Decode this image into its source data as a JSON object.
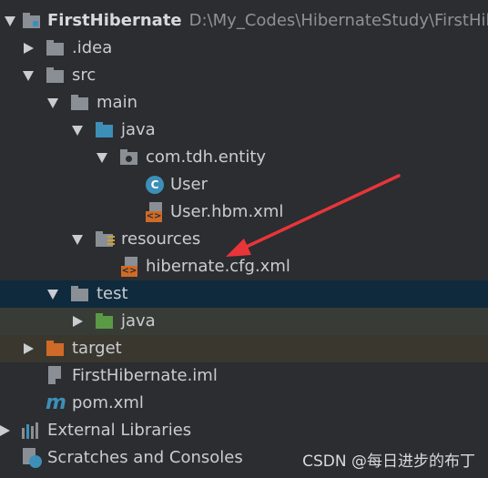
{
  "tree": {
    "project": {
      "name": "FirstHibernate",
      "path": "D:\\My_Codes\\HibernateStudy\\FirstHiber"
    },
    "idea": ".idea",
    "src": "src",
    "main": "main",
    "java_main": "java",
    "package": "com.tdh.entity",
    "user_class": "User",
    "user_xml": "User.hbm.xml",
    "resources": "resources",
    "hibernate_cfg": "hibernate.cfg.xml",
    "test": "test",
    "java_test": "java",
    "target": "target",
    "iml": "FirstHibernate.iml",
    "pom": "pom.xml",
    "external_libraries": "External Libraries",
    "scratches": "Scratches and Consoles"
  },
  "icons": {
    "class_letter": "C",
    "xml_badge": "<>",
    "maven_letter": "m"
  },
  "watermark": "CSDN @每日进步的布丁",
  "annotation_color": "#e8353a"
}
